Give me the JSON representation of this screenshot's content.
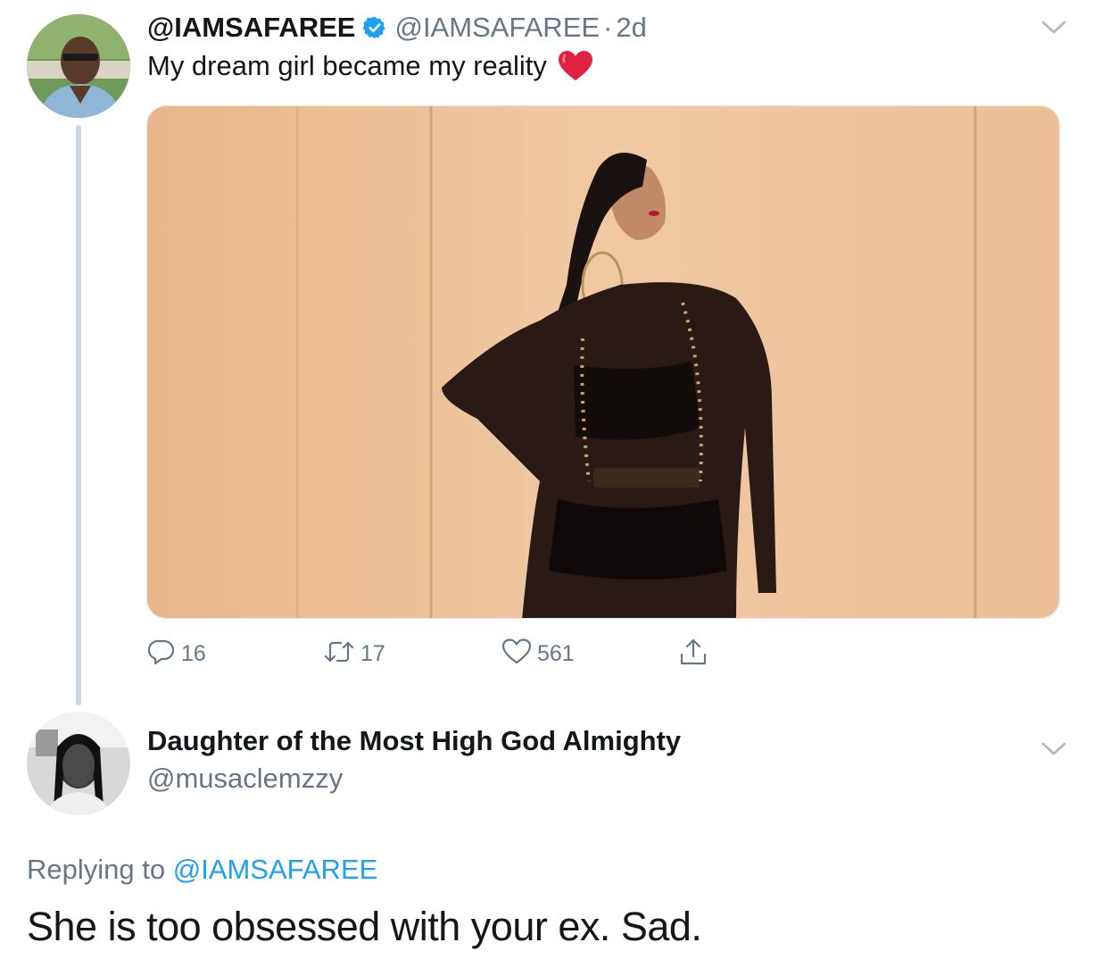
{
  "tweet": {
    "display_name": "@IAMSAFAREE",
    "handle": "@IAMSAFAREE",
    "separator": "·",
    "time": "2d",
    "text": "My dream girl became my reality",
    "emoji_icon": "red-heart-icon",
    "verified_icon": "verified-badge-icon",
    "menu_icon": "chevron-down-icon",
    "actions": {
      "reply_count": "16",
      "retweet_count": "17",
      "like_count": "561"
    }
  },
  "reply": {
    "display_name": "Daughter of the Most High God Almighty",
    "handle": "@musaclemzzy",
    "replying_prefix": "Replying to",
    "replying_mention": "@IAMSAFAREE",
    "text": "She is too obsessed with your ex. Sad.",
    "menu_icon": "chevron-down-icon"
  },
  "colors": {
    "text": "#14171a",
    "secondary": "#657786",
    "accent": "#1da1f2",
    "thread_line": "#ccd6dd",
    "heart": "#e0245e"
  }
}
